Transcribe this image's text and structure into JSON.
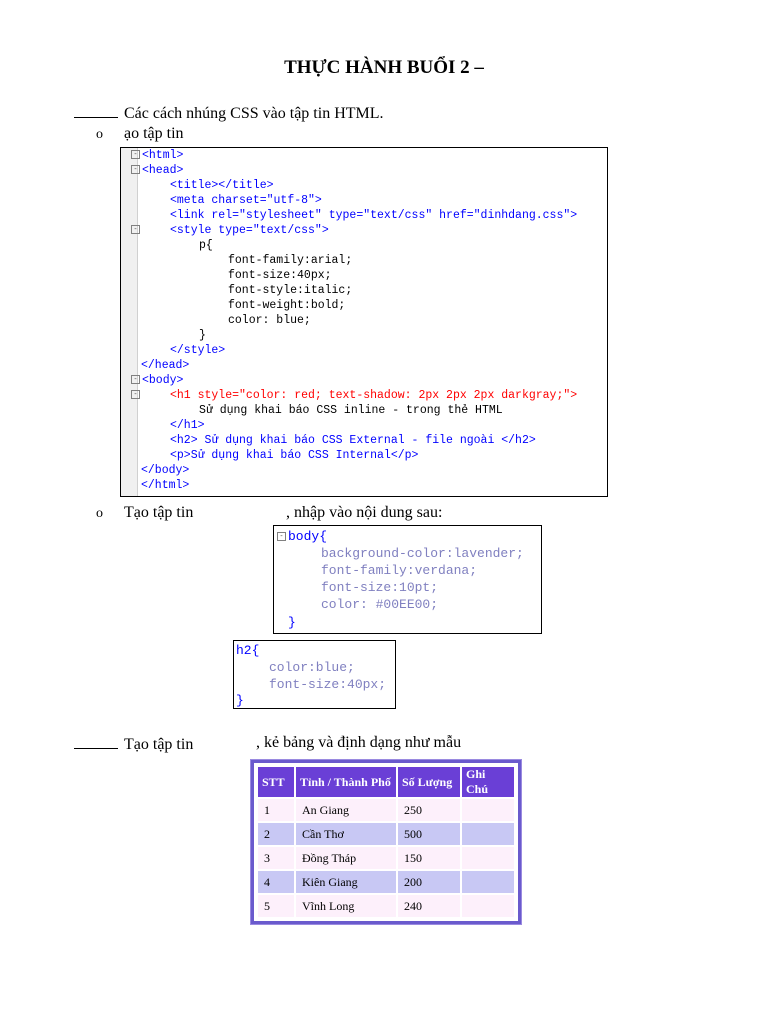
{
  "title": "THỰC HÀNH BUỔI 2 –",
  "section1": {
    "text": "Các cách nhúng CSS vào tập tin HTML."
  },
  "bullet1": {
    "marker": "o",
    "text": "ạo tập tin"
  },
  "code_html": {
    "lines": [
      "<html>",
      "<head>",
      "<title></title>",
      "<meta charset=\"utf-8\">",
      "<link rel=\"stylesheet\" type=\"text/css\" href=\"dinhdang.css\">",
      "<style type=\"text/css\">",
      "p{",
      "font-family:arial;",
      "font-size:40px;",
      "font-style:italic;",
      "font-weight:bold;",
      "color: blue;",
      "}",
      "</style>",
      "</head>",
      "<body>",
      "<h1 style=\"color: red; text-shadow: 2px 2px 2px darkgray;\">",
      "Sử dụng khai báo CSS inline - trong thẻ HTML",
      "</h1>",
      "<h2> Sử dụng khai báo CSS External - file ngoài </h2>",
      "<p>Sử dụng khai báo CSS Internal</p>",
      "</body>",
      "</html>"
    ]
  },
  "bullet2": {
    "marker": "o",
    "text_a": "Tạo tập tin",
    "text_b": ", nhập vào nội dung sau:"
  },
  "code_css_body": {
    "lines": [
      "body{",
      "background-color:lavender;",
      "font-family:verdana;",
      "font-size:10pt;",
      "color: #00EE00;",
      "}"
    ]
  },
  "code_css_h2": {
    "lines": [
      "h2{",
      "color:blue;",
      "font-size:40px;",
      "}"
    ]
  },
  "section2": {
    "text_a": "Tạo tập tin",
    "text_b": ", kẻ bảng và định dạng như mẫu"
  },
  "table": {
    "headers": [
      "STT",
      "Tỉnh / Thành Phố",
      "Số Lượng",
      "Ghi Chú"
    ],
    "rows": [
      [
        "1",
        "An Giang",
        "250",
        ""
      ],
      [
        "2",
        "Cần Thơ",
        "500",
        ""
      ],
      [
        "3",
        "Đồng Tháp",
        "150",
        ""
      ],
      [
        "4",
        "Kiên Giang",
        "200",
        ""
      ],
      [
        "5",
        "Vĩnh Long",
        "240",
        ""
      ]
    ]
  }
}
